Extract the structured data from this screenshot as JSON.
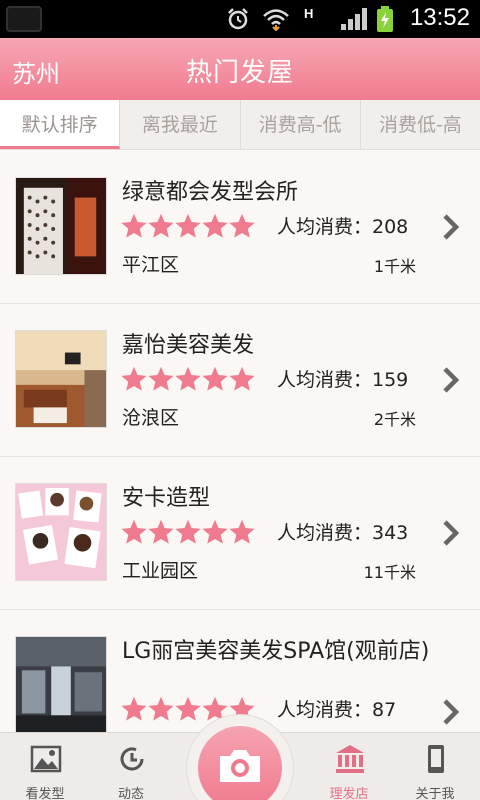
{
  "status_bar": {
    "time": "13:52",
    "network": "H"
  },
  "header": {
    "city": "苏州",
    "title": "热门发屋"
  },
  "sort_tabs": [
    {
      "label": "默认排序",
      "active": true
    },
    {
      "label": "离我最近",
      "active": false
    },
    {
      "label": "消费高-低",
      "active": false
    },
    {
      "label": "消费低-高",
      "active": false
    }
  ],
  "salons": [
    {
      "name": "绿意都会发型会所",
      "rating": 5,
      "avg_label": "人均消费：208",
      "district": "平江区",
      "distance": "1千米"
    },
    {
      "name": "嘉怡美容美发",
      "rating": 5,
      "avg_label": "人均消费：159",
      "district": "沧浪区",
      "distance": "2千米"
    },
    {
      "name": "安卡造型",
      "rating": 5,
      "avg_label": "人均消费：343",
      "district": "工业园区",
      "distance": "11千米"
    },
    {
      "name": "LG丽宫美容美发SPA馆(观前店)",
      "rating": 5,
      "avg_label": "人均消费：87",
      "district": "",
      "distance": ""
    }
  ],
  "bottom_nav": [
    {
      "label": "看发型",
      "icon": "image-icon",
      "active": false
    },
    {
      "label": "动态",
      "icon": "clock-icon",
      "active": false
    },
    {
      "label": "理发店",
      "icon": "bank-icon",
      "active": true
    },
    {
      "label": "关于我",
      "icon": "phone-icon",
      "active": false
    }
  ],
  "colors": {
    "accent": "#f07b8f",
    "star": "#f07b8f",
    "active_text": "#e36f86"
  }
}
